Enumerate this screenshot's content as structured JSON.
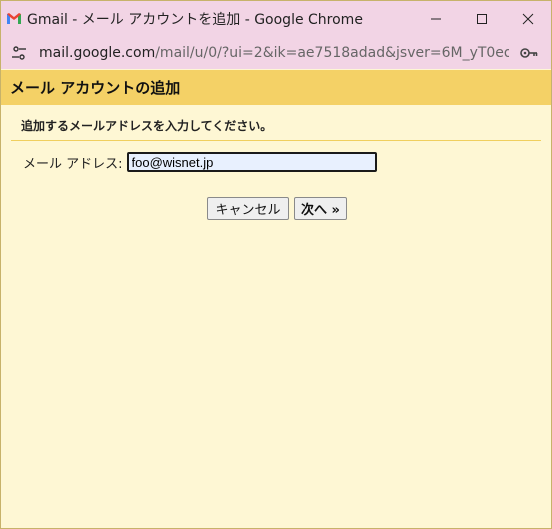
{
  "window": {
    "title": "Gmail - メール アカウントを追加 - Google Chrome"
  },
  "urlbar": {
    "host": "mail.google.com",
    "path": "/mail/u/0/?ui=2&ik=ae7518adad&jsver=6M_yT0eoRaY.ja..."
  },
  "page": {
    "title": "メール アカウントの追加",
    "instruction": "追加するメールアドレスを入力してください。"
  },
  "form": {
    "email_label": "メール アドレス:",
    "email_value": "foo@wisnet.jp"
  },
  "buttons": {
    "cancel_label": "キャンセル",
    "next_label": "次へ »"
  },
  "colors": {
    "titlebar": "#f2d4e5",
    "header": "#f4d166",
    "background": "#fef7d4",
    "input_bg": "#e8f0fe"
  }
}
